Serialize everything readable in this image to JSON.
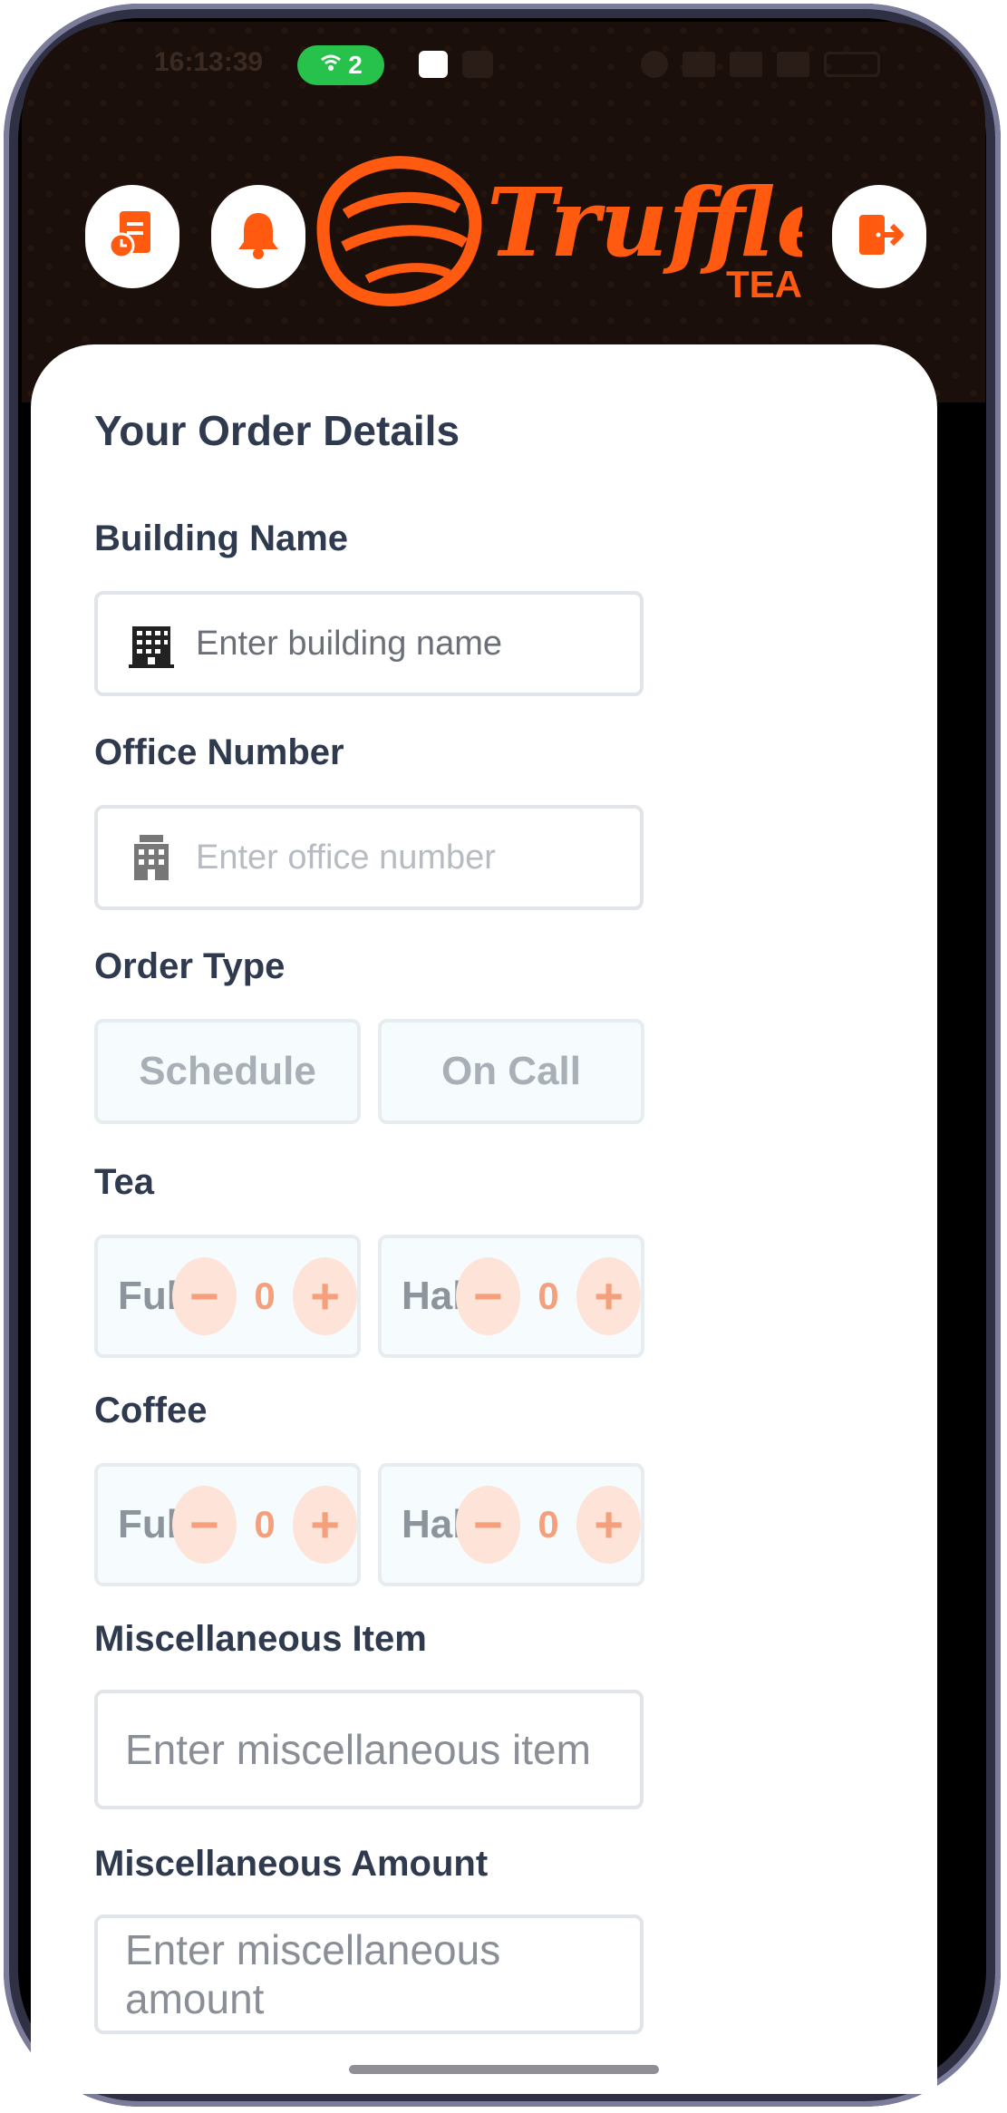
{
  "status_bar": {
    "time": "16:13:39",
    "hotspot_count": "2"
  },
  "brand": {
    "name": "Truffle",
    "sub": "TEA"
  },
  "form": {
    "title": "Your Order Details",
    "building": {
      "label": "Building Name",
      "placeholder": "Enter building name"
    },
    "office": {
      "label": "Office Number",
      "placeholder": "Enter office number"
    },
    "order_type": {
      "label": "Order Type",
      "options": [
        "Schedule",
        "On Call"
      ]
    },
    "tea": {
      "label": "Tea",
      "full_label": "Full",
      "full_value": "0",
      "half_label": "Half",
      "half_value": "0"
    },
    "coffee": {
      "label": "Coffee",
      "full_label": "Full",
      "full_value": "0",
      "half_label": "Half",
      "half_value": "0"
    },
    "misc_item": {
      "label": "Miscellaneous Item",
      "placeholder": "Enter miscellaneous item"
    },
    "misc_amount": {
      "label": "Miscellaneous Amount",
      "placeholder": "Enter miscellaneous amount"
    }
  },
  "colors": {
    "accent": "#ff5a10",
    "header_bg": "#1a0f0a",
    "label": "#2f3a4f"
  }
}
